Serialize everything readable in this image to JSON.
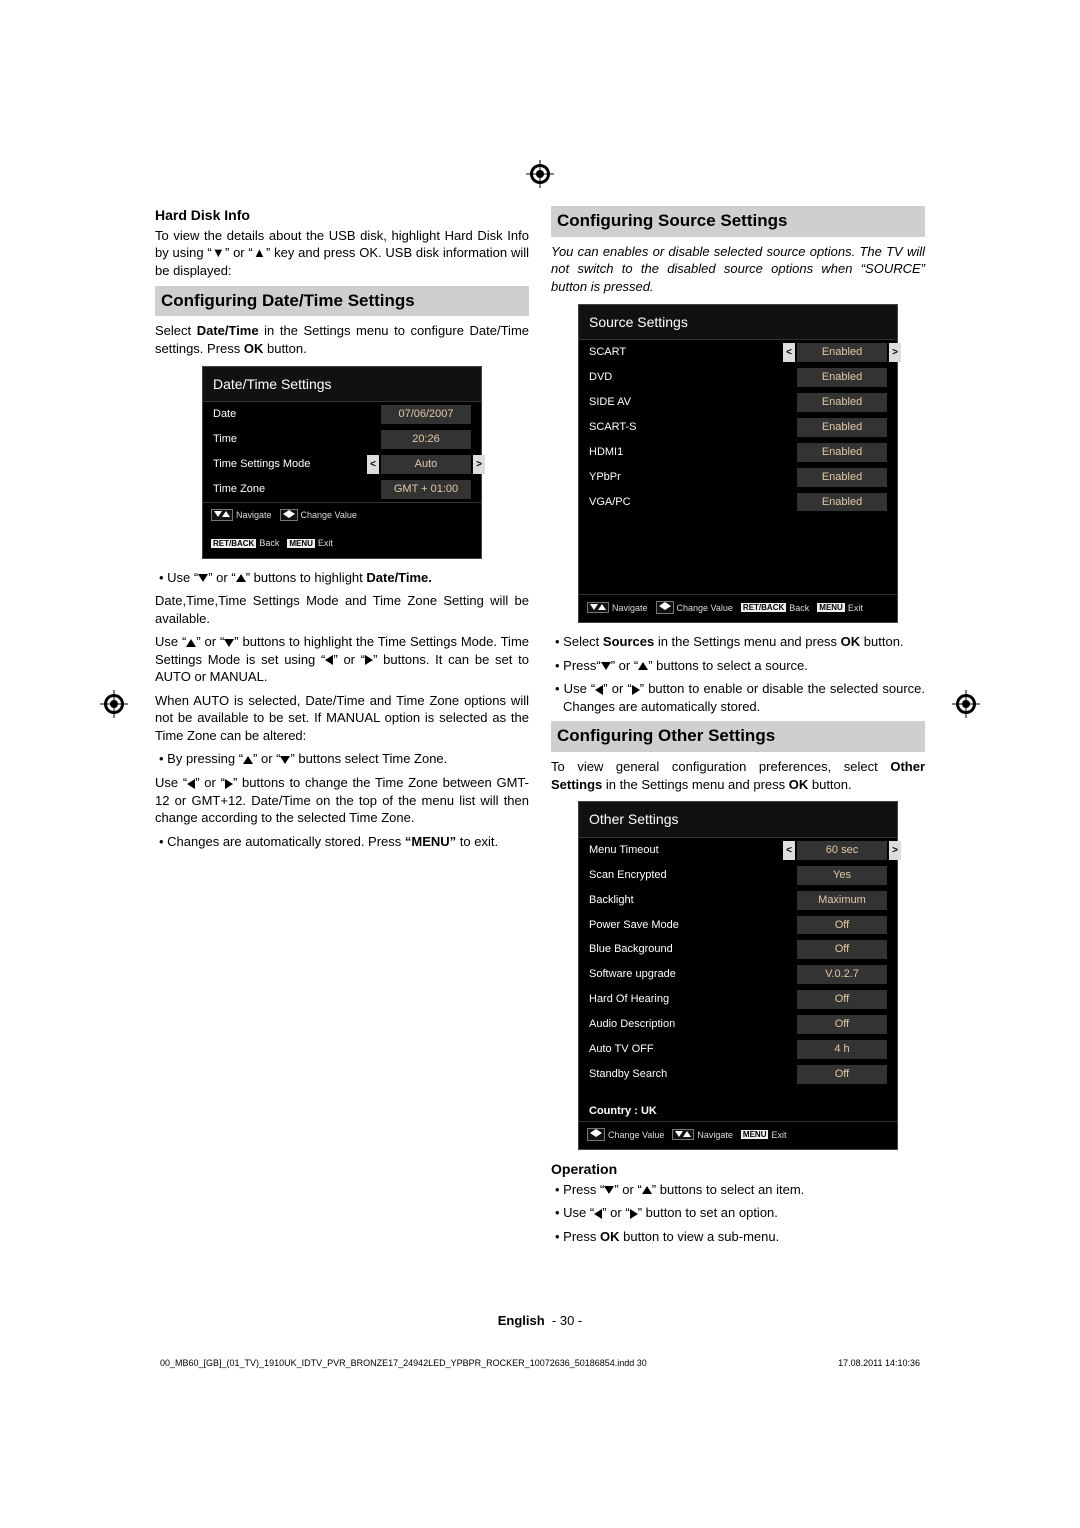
{
  "hardDisk": {
    "heading": "Hard Disk Info",
    "body": "To view the details about the USB disk, highlight Hard Disk Info by using “▼” or “▲” key and press OK. USB disk information will be displayed:"
  },
  "dateTime": {
    "heading": "Configuring Date/Time Settings",
    "intro1": "Select ",
    "intro1b": "Date/Time",
    "intro2": " in the Settings menu to configure Date/Time settings. Press ",
    "intro2b": "OK",
    "intro3": " button.",
    "bul1a": "• Use “",
    "bul1b": "” or “",
    "bul1c": "” buttons to highlight ",
    "bul1d": "Date/Time.",
    "p1": "Date,Time,Time Settings Mode and Time Zone Setting will be available.",
    "p2a": "Use “",
    "p2b": "” or “",
    "p2c": "” buttons to highlight the Time Settings Mode. Time Settings Mode is set using “",
    "p2d": "” or “",
    "p2e": "” buttons. It can be set to AUTO or MANUAL.",
    "p3": "When AUTO is selected, Date/Time and Time Zone options will not be available to be set. If MANUAL option is selected as the Time Zone can be altered:",
    "bul2a": "• By pressing “",
    "bul2b": "” or “",
    "bul2c": "” buttons select Time Zone.",
    "p4a": "Use “",
    "p4b": "” or “",
    "p4c": "” buttons to change the Time Zone between GMT-12 or GMT+12. Date/Time on the top of the menu list will then change according to the selected Time Zone.",
    "bul3a": "• Changes are automatically stored. Press ",
    "bul3b": "“MENU”",
    "bul3c": " to exit."
  },
  "dtOsd": {
    "title": "Date/Time Settings",
    "rows": [
      {
        "label": "Date",
        "value": "07/06/2007"
      },
      {
        "label": "Time",
        "value": "20:26"
      },
      {
        "label": "Time Settings Mode",
        "value": "Auto",
        "scroll": true
      },
      {
        "label": "Time Zone",
        "value": "GMT + 01:00"
      }
    ],
    "hints": {
      "nav": "Navigate",
      "back": "Back",
      "backBtn": "RET/BACK",
      "change": "Change Value",
      "exit": "Exit",
      "menu": "MENU"
    }
  },
  "source": {
    "heading": "Configuring Source Settings",
    "note": "You can enables or disable selected source options. The TV will not switch to the disabled source options when “SOURCE” button is pressed.",
    "osd": {
      "title": "Source Settings",
      "rows": [
        {
          "label": "SCART",
          "value": "Enabled",
          "scroll": true
        },
        {
          "label": "DVD",
          "value": "Enabled"
        },
        {
          "label": "SIDE AV",
          "value": "Enabled"
        },
        {
          "label": "SCART-S",
          "value": "Enabled"
        },
        {
          "label": "HDMI1",
          "value": "Enabled"
        },
        {
          "label": "YPbPr",
          "value": "Enabled"
        },
        {
          "label": "VGA/PC",
          "value": "Enabled"
        }
      ],
      "hints": {
        "nav": "Navigate",
        "change": "Change Value",
        "back": "Back",
        "backBtn": "RET/BACK",
        "exit": "Exit",
        "menu": "MENU"
      }
    },
    "bul1a": "• Select ",
    "bul1b": "Sources",
    "bul1c": " in the Settings menu and press ",
    "bul1d": "OK",
    "bul1e": " button.",
    "bul2a": "• Press“",
    "bul2b": "” or “",
    "bul2c": "” buttons to select a source.",
    "bul3a": "• Use “",
    "bul3b": "” or “",
    "bul3c": "” button to enable or disable the selected source. Changes are automatically stored."
  },
  "other": {
    "heading": "Configuring Other Settings",
    "intro1": "To view general configuration preferences, select ",
    "intro1b": "Other Settings",
    "intro2": " in the Settings menu and press ",
    "intro2b": "OK",
    "intro3": " button.",
    "osd": {
      "title": "Other Settings",
      "rows": [
        {
          "label": "Menu Timeout",
          "value": "60 sec",
          "scroll": true
        },
        {
          "label": "Scan Encrypted",
          "value": "Yes"
        },
        {
          "label": "Backlight",
          "value": "Maximum"
        },
        {
          "label": "Power Save Mode",
          "value": "Off"
        },
        {
          "label": "Blue Background",
          "value": "Off"
        },
        {
          "label": "Software upgrade",
          "value": "V.0.2.7"
        },
        {
          "label": "Hard Of Hearing",
          "value": "Off"
        },
        {
          "label": "Audio Description",
          "value": "Off"
        },
        {
          "label": "Auto TV OFF",
          "value": "4 h"
        },
        {
          "label": "Standby Search",
          "value": "Off"
        }
      ],
      "country": "Country : UK",
      "hints": {
        "change": "Change Value",
        "nav": "Navigate",
        "exit": "Exit",
        "menu": "MENU"
      }
    },
    "opHeading": "Operation",
    "op1a": "• Press “",
    "op1b": "” or “",
    "op1c": "” buttons to select an item.",
    "op2a": "• Use “",
    "op2b": "” or “",
    "op2c": "” button to set an option.",
    "op3a": "• Press ",
    "op3b": "OK",
    "op3c": " button to view a sub-menu."
  },
  "pageFoot": {
    "lang": "English",
    "num": "- 30 -"
  },
  "printFoot": {
    "file": "00_MB60_[GB]_(01_TV)_1910UK_IDTV_PVR_BRONZE17_24942LED_YPBPR_ROCKER_10072636_50186854.indd   30",
    "date": "17.08.2011   14:10:36"
  }
}
